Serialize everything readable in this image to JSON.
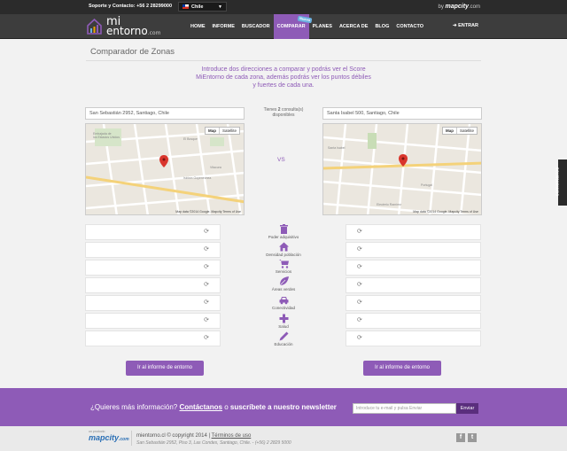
{
  "topbar": {
    "support": "Soporte y Contacto: +56 2 28299000",
    "country": "Chile",
    "by": "by",
    "mapcity": "mapcity",
    "mapcity_suffix": ".com"
  },
  "nav": {
    "logo_line1": "mi",
    "logo_line2": "entorno",
    "logo_suffix": ".com",
    "items": [
      {
        "label": "HOME"
      },
      {
        "label": "INFORME"
      },
      {
        "label": "BUSCADOR"
      },
      {
        "label": "COMPARAR",
        "badge": "Nuevo"
      },
      {
        "label": "PLANES"
      },
      {
        "label": "ACERCA DE"
      },
      {
        "label": "BLOG"
      },
      {
        "label": "CONTACTO"
      }
    ],
    "login": "ENTRAR"
  },
  "page": {
    "title": "Comparador de Zonas",
    "intro": "Introduce dos direcciones a comparar y podrás ver el Score MiEntorno de cada zona, además podrás ver los puntos débiles y fuertes de cada una.",
    "address_left": "San Sebastián 2952, Santiago, Chile",
    "address_right": "Santa Isabel 500, Santiago, Chile",
    "consultas_prefix": "Tienes",
    "consultas_count": "2",
    "consultas_suffix": "consulta(s) disponibles",
    "vs": "VS",
    "map_toggle_map": "Map",
    "map_toggle_sat": "Satellite",
    "map_footer": "Map data ©2014 Google, Mapcity  Terms of Use"
  },
  "categories": [
    {
      "label": "Poder adquisitivo",
      "icon": "trash-can-icon"
    },
    {
      "label": "Densidad población",
      "icon": "house-icon"
    },
    {
      "label": "Servicios",
      "icon": "shopping-cart-icon"
    },
    {
      "label": "Áreas verdes",
      "icon": "leaf-icon"
    },
    {
      "label": "Conectividad",
      "icon": "car-icon"
    },
    {
      "label": "Salud",
      "icon": "plus-icon"
    },
    {
      "label": "Educación",
      "icon": "pencil-icon"
    }
  ],
  "spinner": "⟳",
  "buttons": {
    "informe_left": "Ir al informe de entorno",
    "informe_right": "Ir al informe de entorno"
  },
  "newsletter": {
    "question": "¿Quieres más información?",
    "contact_link": "Contáctanos",
    "or": "o",
    "subscribe": "suscríbete a nuestro newsletter",
    "placeholder": "Introduce tu e-mail y pulsa Enviar",
    "send": "Enviar"
  },
  "footer": {
    "developed_by": "un producto",
    "brand": "mapcity",
    "brand_suffix": ".com",
    "copyright": "mientorno.cl © copyright 2014",
    "terms": "Términos de uso",
    "address": "San Sebastián 2952, Piso 3, Las Condes, Santiago, Chile. - (+56) 2 2829 5000",
    "facebook": "f",
    "twitter": "t"
  },
  "side_tab": "comentarios",
  "colors": {
    "accent": "#8e5bb7",
    "topbar": "#2b2b2b",
    "navbar": "#3d3d3d"
  }
}
